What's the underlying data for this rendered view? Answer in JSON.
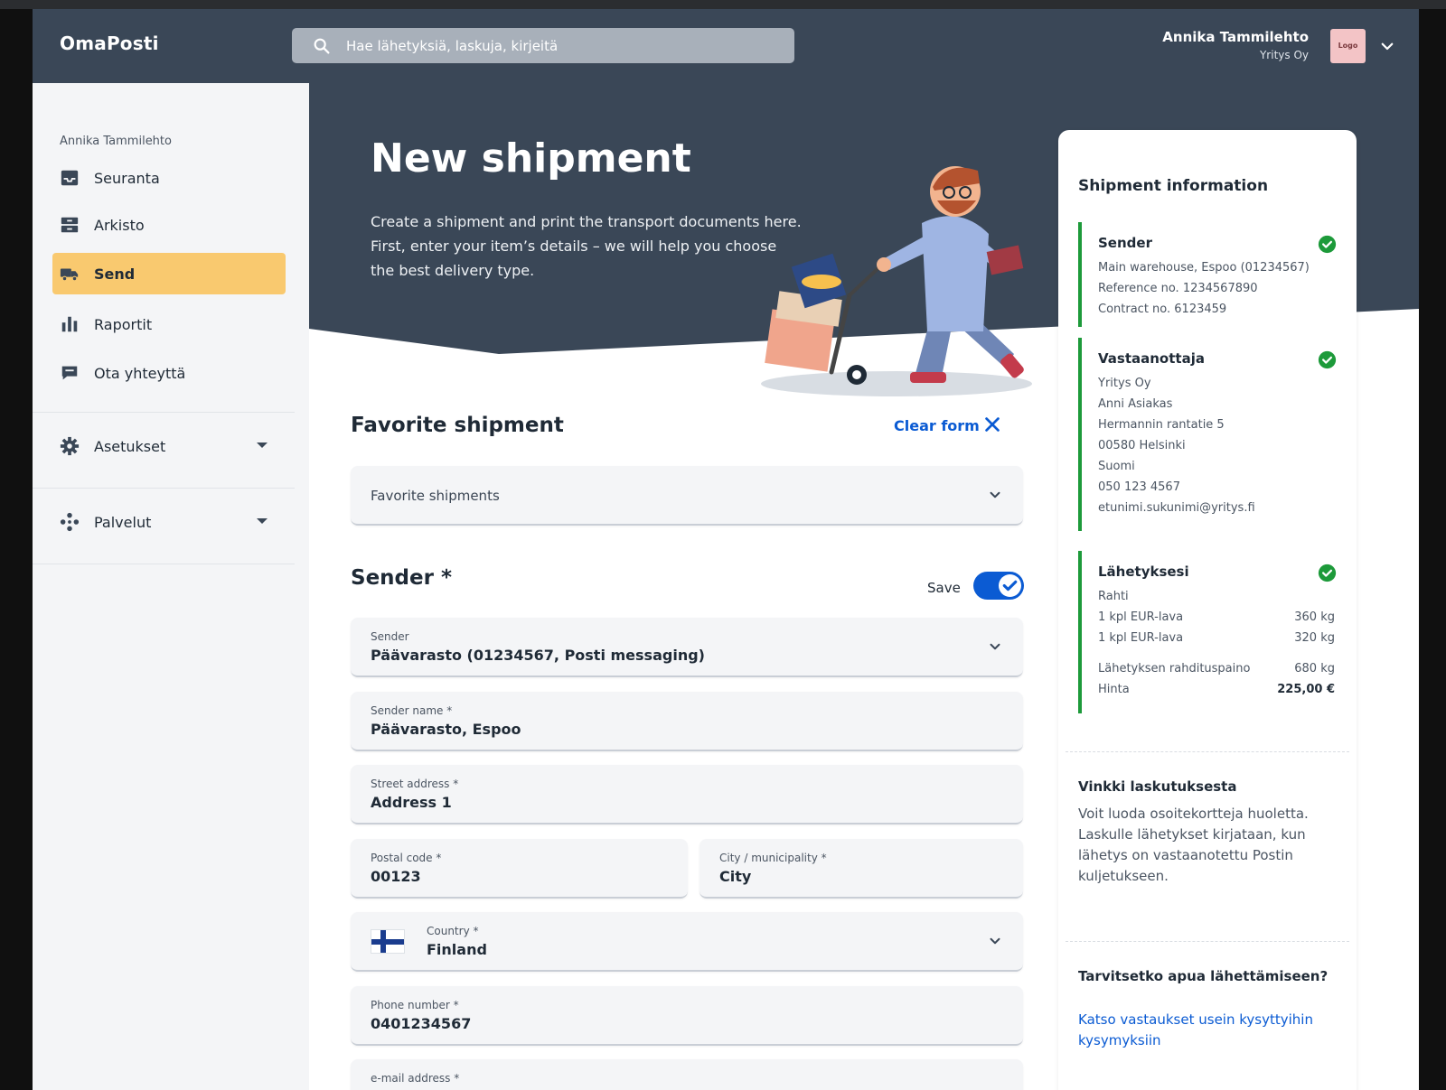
{
  "app": {
    "brand": "OmaPosti"
  },
  "search": {
    "placeholder": "Hae lähetyksiä, laskuja, kirjeitä"
  },
  "user": {
    "name": "Annika Tammilehto",
    "company": "Yritys Oy",
    "logo_text": "Logo"
  },
  "sidebar": {
    "user_name": "Annika Tammilehto",
    "items": [
      {
        "label": "Seuranta",
        "icon": "inbox-icon"
      },
      {
        "label": "Arkisto",
        "icon": "archive-icon"
      },
      {
        "label": "Send",
        "icon": "truck-icon",
        "active": true
      },
      {
        "label": "Raportit",
        "icon": "bar-chart-icon"
      },
      {
        "label": "Ota yhteyttä",
        "icon": "chat-icon"
      },
      {
        "label": "Asetukset",
        "icon": "gear-icon"
      },
      {
        "label": "Palvelut",
        "icon": "services-icon"
      }
    ]
  },
  "hero": {
    "title": "New shipment",
    "text": "Create a shipment and print the transport documents here. First, enter your item’s details – we will help you choose the best delivery type."
  },
  "favorite": {
    "title": "Favorite shipment",
    "clear_label": "Clear form",
    "select_placeholder": "Favorite shipments"
  },
  "sender_form": {
    "title": "Sender *",
    "save_label": "Save",
    "save_on": true,
    "fields": {
      "sender": {
        "label": "Sender",
        "value": "Päävarasto (01234567, Posti messaging)"
      },
      "sender_name": {
        "label": "Sender name *",
        "value": "Päävarasto, Espoo"
      },
      "street": {
        "label": "Street address *",
        "value": "Address 1"
      },
      "postal": {
        "label": "Postal code *",
        "value": "00123"
      },
      "city": {
        "label": "City / municipality *",
        "value": "City"
      },
      "country": {
        "label": "Country *",
        "value": "Finland"
      },
      "phone": {
        "label": "Phone number  *",
        "value": "0401234567"
      },
      "email": {
        "label": "e-mail address *",
        "value": ""
      }
    }
  },
  "panel": {
    "title": "Shipment information",
    "sender": {
      "title": "Sender",
      "lines": [
        "Main warehouse, Espoo (01234567)",
        "Reference no. 1234567890",
        "Contract no. 6123459"
      ]
    },
    "recipient": {
      "title": "Vastaanottaja",
      "lines": [
        "Yritys Oy",
        "Anni Asiakas",
        "Hermannin rantatie 5",
        "00580 Helsinki",
        "Suomi",
        "050 123 4567",
        "etunimi.sukunimi@yritys.fi"
      ]
    },
    "shipment": {
      "title": "Lähetyksesi",
      "type": "Rahti",
      "items": [
        {
          "label": "1 kpl EUR-lava",
          "value": "360 kg"
        },
        {
          "label": "1 kpl EUR-lava",
          "value": "320 kg"
        }
      ],
      "weight_label": "Lähetyksen rahdituspaino",
      "weight_value": "680 kg",
      "price_label": "Hinta",
      "price_value": "225,00 €"
    },
    "tip": {
      "title": "Vinkki laskutuksesta",
      "text": "Voit luoda osoitekortteja huoletta. Laskulle lähetykset kirjataan, kun lähetys on vastaanotettu Postin kuljetukseen."
    },
    "help": {
      "title": "Tarvitsetko apua lähettämiseen?",
      "link": "Katso vastaukset usein kysyttyihin kysymyksiin"
    }
  },
  "colors": {
    "header_bg": "#3a4757",
    "accent_blue": "#0b5bd3",
    "active_nav": "#f9c96f",
    "success_green": "#1d9a3a"
  }
}
